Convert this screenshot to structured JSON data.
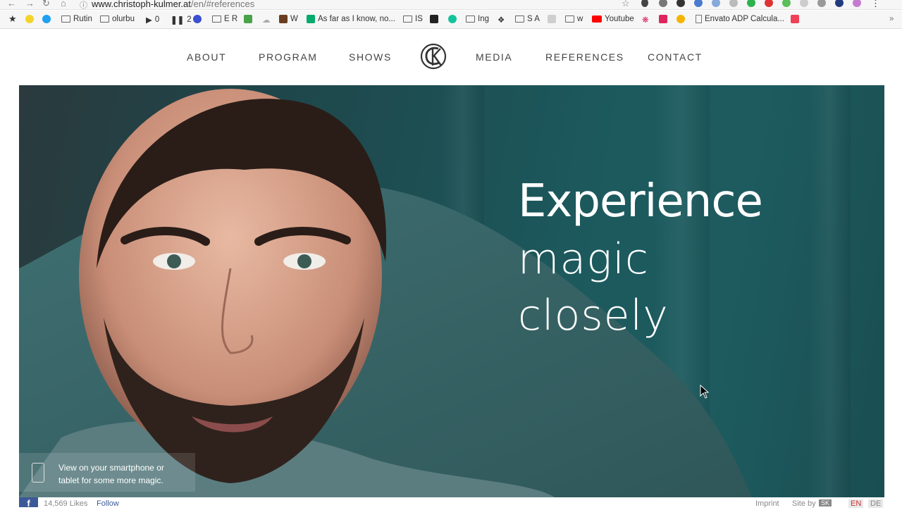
{
  "browser": {
    "url_host": "www.christoph-kulmer.at",
    "url_path": "/en/#references",
    "bookmarks": [
      {
        "label": "Rutin",
        "kind": "folder"
      },
      {
        "label": "olurbu",
        "kind": "folder"
      },
      {
        "label": "0",
        "kind": "play"
      },
      {
        "label": "2",
        "kind": "pause"
      },
      {
        "label": "E R",
        "kind": "folder"
      },
      {
        "label": "W",
        "kind": "fav"
      },
      {
        "label": "As far as I know, no...",
        "kind": "fav"
      },
      {
        "label": "IS",
        "kind": "folder"
      },
      {
        "label": "Ing",
        "kind": "folder"
      },
      {
        "label": "S A",
        "kind": "folder"
      },
      {
        "label": "w",
        "kind": "folder"
      },
      {
        "label": "Youtube",
        "kind": "fav"
      },
      {
        "label": "Envato ADP Calcula...",
        "kind": "page"
      }
    ]
  },
  "nav": {
    "about": "ABOUT",
    "program": "PROGRAM",
    "shows": "SHOWS",
    "media": "MEDIA",
    "references": "REFERENCES",
    "contact": "CONTACT"
  },
  "hero": {
    "line1": "Experience",
    "line2": "magic",
    "line3": "closely",
    "mobile_note_line1": "View on your smartphone or",
    "mobile_note_line2": "tablet for some more magic."
  },
  "footer": {
    "likes": "14,569 Likes",
    "follow": "Follow",
    "imprint": "Imprint",
    "site_by": "Site by",
    "site_by_badge": "SK",
    "lang_en": "EN",
    "lang_de": "DE"
  },
  "colors": {
    "hero_teal": "#1d5b5f",
    "facebook_blue": "#3b5998",
    "nav_text": "#444444"
  }
}
